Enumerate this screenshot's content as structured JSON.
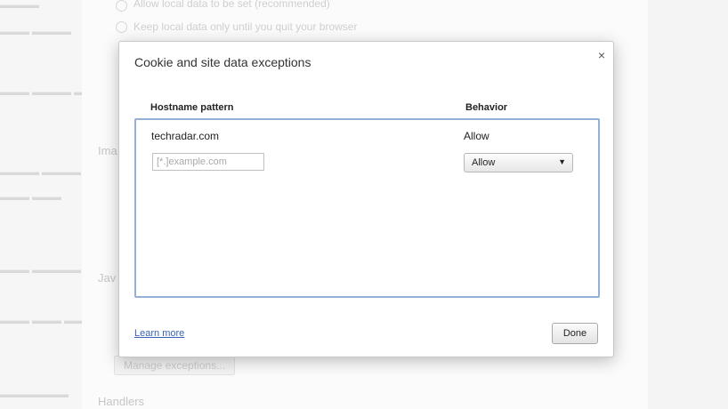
{
  "background": {
    "radio_option_1": "Allow local data to be set (recommended)",
    "radio_option_2": "Keep local data only until you quit your browser",
    "section_images_fragment": "Ima",
    "section_javascript_fragment": "Jav",
    "manage_exceptions_button": "Manage exceptions...",
    "section_handlers": "Handlers"
  },
  "dialog": {
    "title": "Cookie and site data exceptions",
    "close_glyph": "×",
    "columns": {
      "hostname": "Hostname pattern",
      "behavior": "Behavior"
    },
    "entries": [
      {
        "hostname": "techradar.com",
        "behavior": "Allow"
      }
    ],
    "new_entry": {
      "placeholder": "[*.]example.com",
      "behavior_selected": "Allow",
      "arrow_glyph": "▼"
    },
    "learn_more": "Learn more",
    "done_label": "Done"
  },
  "icons": [
    "close-icon",
    "dropdown-arrow-icon"
  ]
}
